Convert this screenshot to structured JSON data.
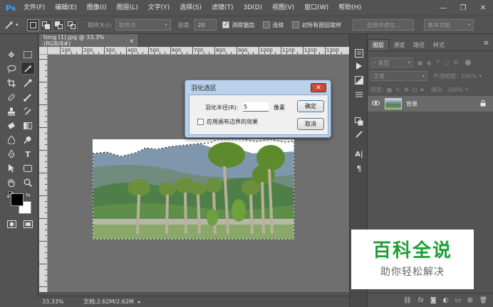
{
  "app": {
    "logo": "Ps"
  },
  "menu": [
    "文件(F)",
    "编辑(E)",
    "图像(I)",
    "图层(L)",
    "文字(Y)",
    "选择(S)",
    "滤镜(T)",
    "3D(D)",
    "视图(V)",
    "窗口(W)",
    "帮助(H)"
  ],
  "window_controls": {
    "minimize": "—",
    "restore": "❐",
    "close": "✕"
  },
  "options": {
    "sample_size_label": "取样大小:",
    "sample_size_value": "取样点",
    "tolerance_label": "容差:",
    "tolerance_value": "20",
    "antialias_label": "消除锯齿",
    "antialias_checked": true,
    "contiguous_label": "连续",
    "contiguous_checked": false,
    "all_layers_label": "对所有图层取样",
    "all_layers_checked": false,
    "refine_edge_label": "选择并遮住...",
    "workspace_label": "基本功能"
  },
  "document": {
    "tab_title": "timg (1).jpg @ 33.3%(RGB/8#)",
    "tab_close": "×",
    "ruler_labels": [
      "100",
      "200",
      "300",
      "400",
      "500",
      "600",
      "700",
      "800",
      "900",
      "1000",
      "1100",
      "1200",
      "1300"
    ]
  },
  "status": {
    "zoom": "33.33%",
    "doc_size": "文档:2.62M/2.62M"
  },
  "layers_panel": {
    "tabs": [
      "图层",
      "通道",
      "路径",
      "样式"
    ],
    "kind_label": "类型",
    "blend_mode": "正常",
    "opacity_label": "不透明度:",
    "opacity_value": "100%",
    "lock_label": "锁定:",
    "fill_label": "填充:",
    "fill_value": "100%",
    "layer_name": "背景",
    "footer_icons": [
      "link-icon",
      "fx-icon",
      "mask-icon",
      "adjustment-icon",
      "group-icon",
      "new-layer-icon",
      "trash-icon"
    ]
  },
  "dialog": {
    "title": "羽化选区",
    "close": "✕",
    "radius_label": "羽化半径(R):",
    "radius_value": "5",
    "radius_unit": "像素",
    "apply_canvas_label": "应用画布边界的效果",
    "apply_canvas_checked": false,
    "ok_label": "确定",
    "cancel_label": "取消"
  },
  "watermark": {
    "main": "百科全说",
    "sub": "助你轻松解决"
  }
}
